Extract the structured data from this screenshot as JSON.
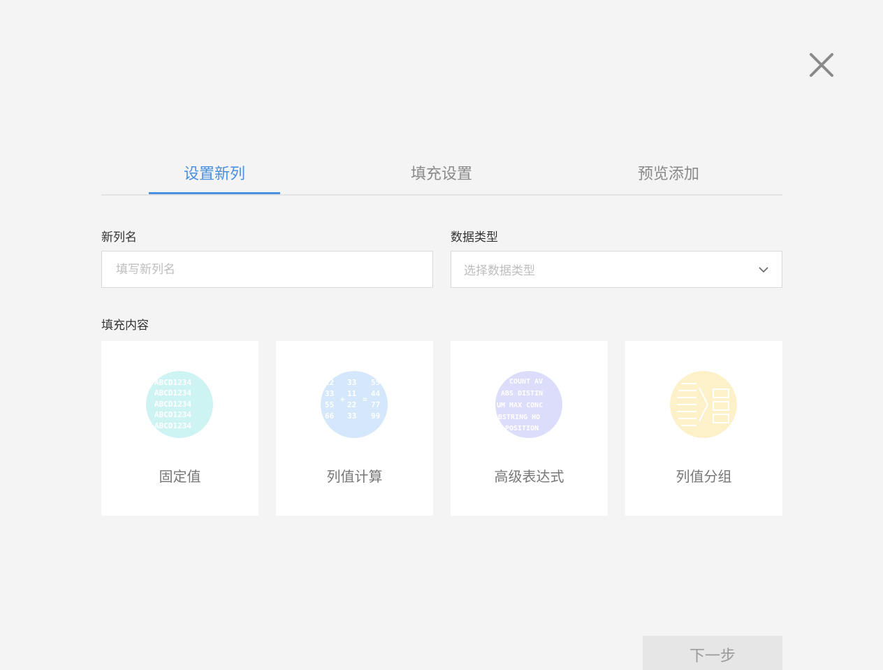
{
  "tabs": [
    {
      "label": "设置新列",
      "active": true
    },
    {
      "label": "填充设置",
      "active": false
    },
    {
      "label": "预览添加",
      "active": false
    }
  ],
  "form": {
    "name_label": "新列名",
    "name_placeholder": "填写新列名",
    "type_label": "数据类型",
    "type_placeholder": "选择数据类型",
    "fill_label": "填充内容"
  },
  "cards": [
    {
      "label": "固定值",
      "icon": "fixed-value-icon",
      "color": "#cdf3f2"
    },
    {
      "label": "列值计算",
      "icon": "column-calc-icon",
      "color": "#d5e7fb"
    },
    {
      "label": "高级表达式",
      "icon": "expression-icon",
      "color": "#dcdcfb"
    },
    {
      "label": "列值分组",
      "icon": "column-group-icon",
      "color": "#fdf1c9"
    }
  ],
  "footer": {
    "next_label": "下一步"
  },
  "colors": {
    "accent": "#4a8fe0",
    "background": "#f4f4f4"
  }
}
